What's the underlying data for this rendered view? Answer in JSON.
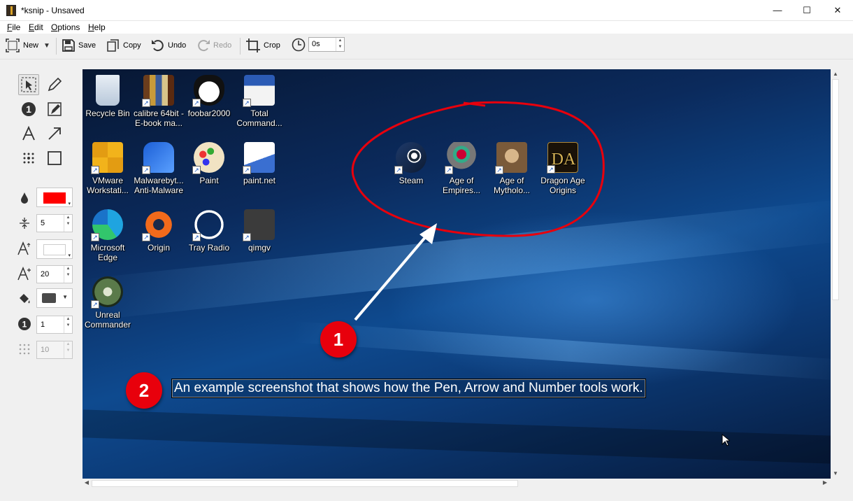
{
  "window": {
    "title": "*ksnip - Unsaved",
    "controls": [
      "—",
      "☐",
      "✕"
    ]
  },
  "menu": [
    {
      "underline": "F",
      "rest": "ile"
    },
    {
      "underline": "E",
      "rest": "dit"
    },
    {
      "underline": "O",
      "rest": "ptions"
    },
    {
      "underline": "H",
      "rest": "elp"
    }
  ],
  "toolbar": {
    "new_label": "New",
    "save_label": "Save",
    "copy_label": "Copy",
    "undo_label": "Undo",
    "redo_label": "Redo",
    "crop_label": "Crop",
    "delay_value": "0s"
  },
  "side": {
    "width_value": "5",
    "font_size_value": "20",
    "number_value": "1",
    "obfuscate_value": "10",
    "color": "#ff0000",
    "fill_color": "#4a4a4a"
  },
  "desktop": {
    "icons": [
      {
        "label": "Recycle Bin",
        "icon": "recycle-bin-icon"
      },
      {
        "label": "calibre 64bit - E-book ma...",
        "icon": "calibre-icon"
      },
      {
        "label": "foobar2000",
        "icon": "foobar-icon"
      },
      {
        "label": "Total Command...",
        "icon": "total-commander-icon"
      },
      {
        "label": "VMware Workstati...",
        "icon": "vmware-icon"
      },
      {
        "label": "Malwarebyt... Anti-Malware",
        "icon": "malwarebytes-icon"
      },
      {
        "label": "Paint",
        "icon": "paint-icon"
      },
      {
        "label": "paint.net",
        "icon": "paintnet-icon"
      },
      {
        "label": "Microsoft Edge",
        "icon": "edge-icon"
      },
      {
        "label": "Origin",
        "icon": "origin-icon"
      },
      {
        "label": "Tray Radio",
        "icon": "tray-radio-icon"
      },
      {
        "label": "qimgv",
        "icon": "qimgv-icon"
      },
      {
        "label": "Unreal Commander",
        "icon": "unreal-commander-icon"
      },
      {
        "label": "Steam",
        "icon": "steam-icon"
      },
      {
        "label": "Age of Empires...",
        "icon": "age-of-empires-icon"
      },
      {
        "label": "Age of Mytholo...",
        "icon": "age-of-mythology-icon"
      },
      {
        "label": "Dragon Age Origins",
        "icon": "dragon-age-icon"
      }
    ]
  },
  "annotations": {
    "badge_1": "1",
    "badge_2": "2",
    "text": "An example screenshot that shows how the Pen, Arrow and Number tools work.",
    "accent": "#e8000c"
  }
}
